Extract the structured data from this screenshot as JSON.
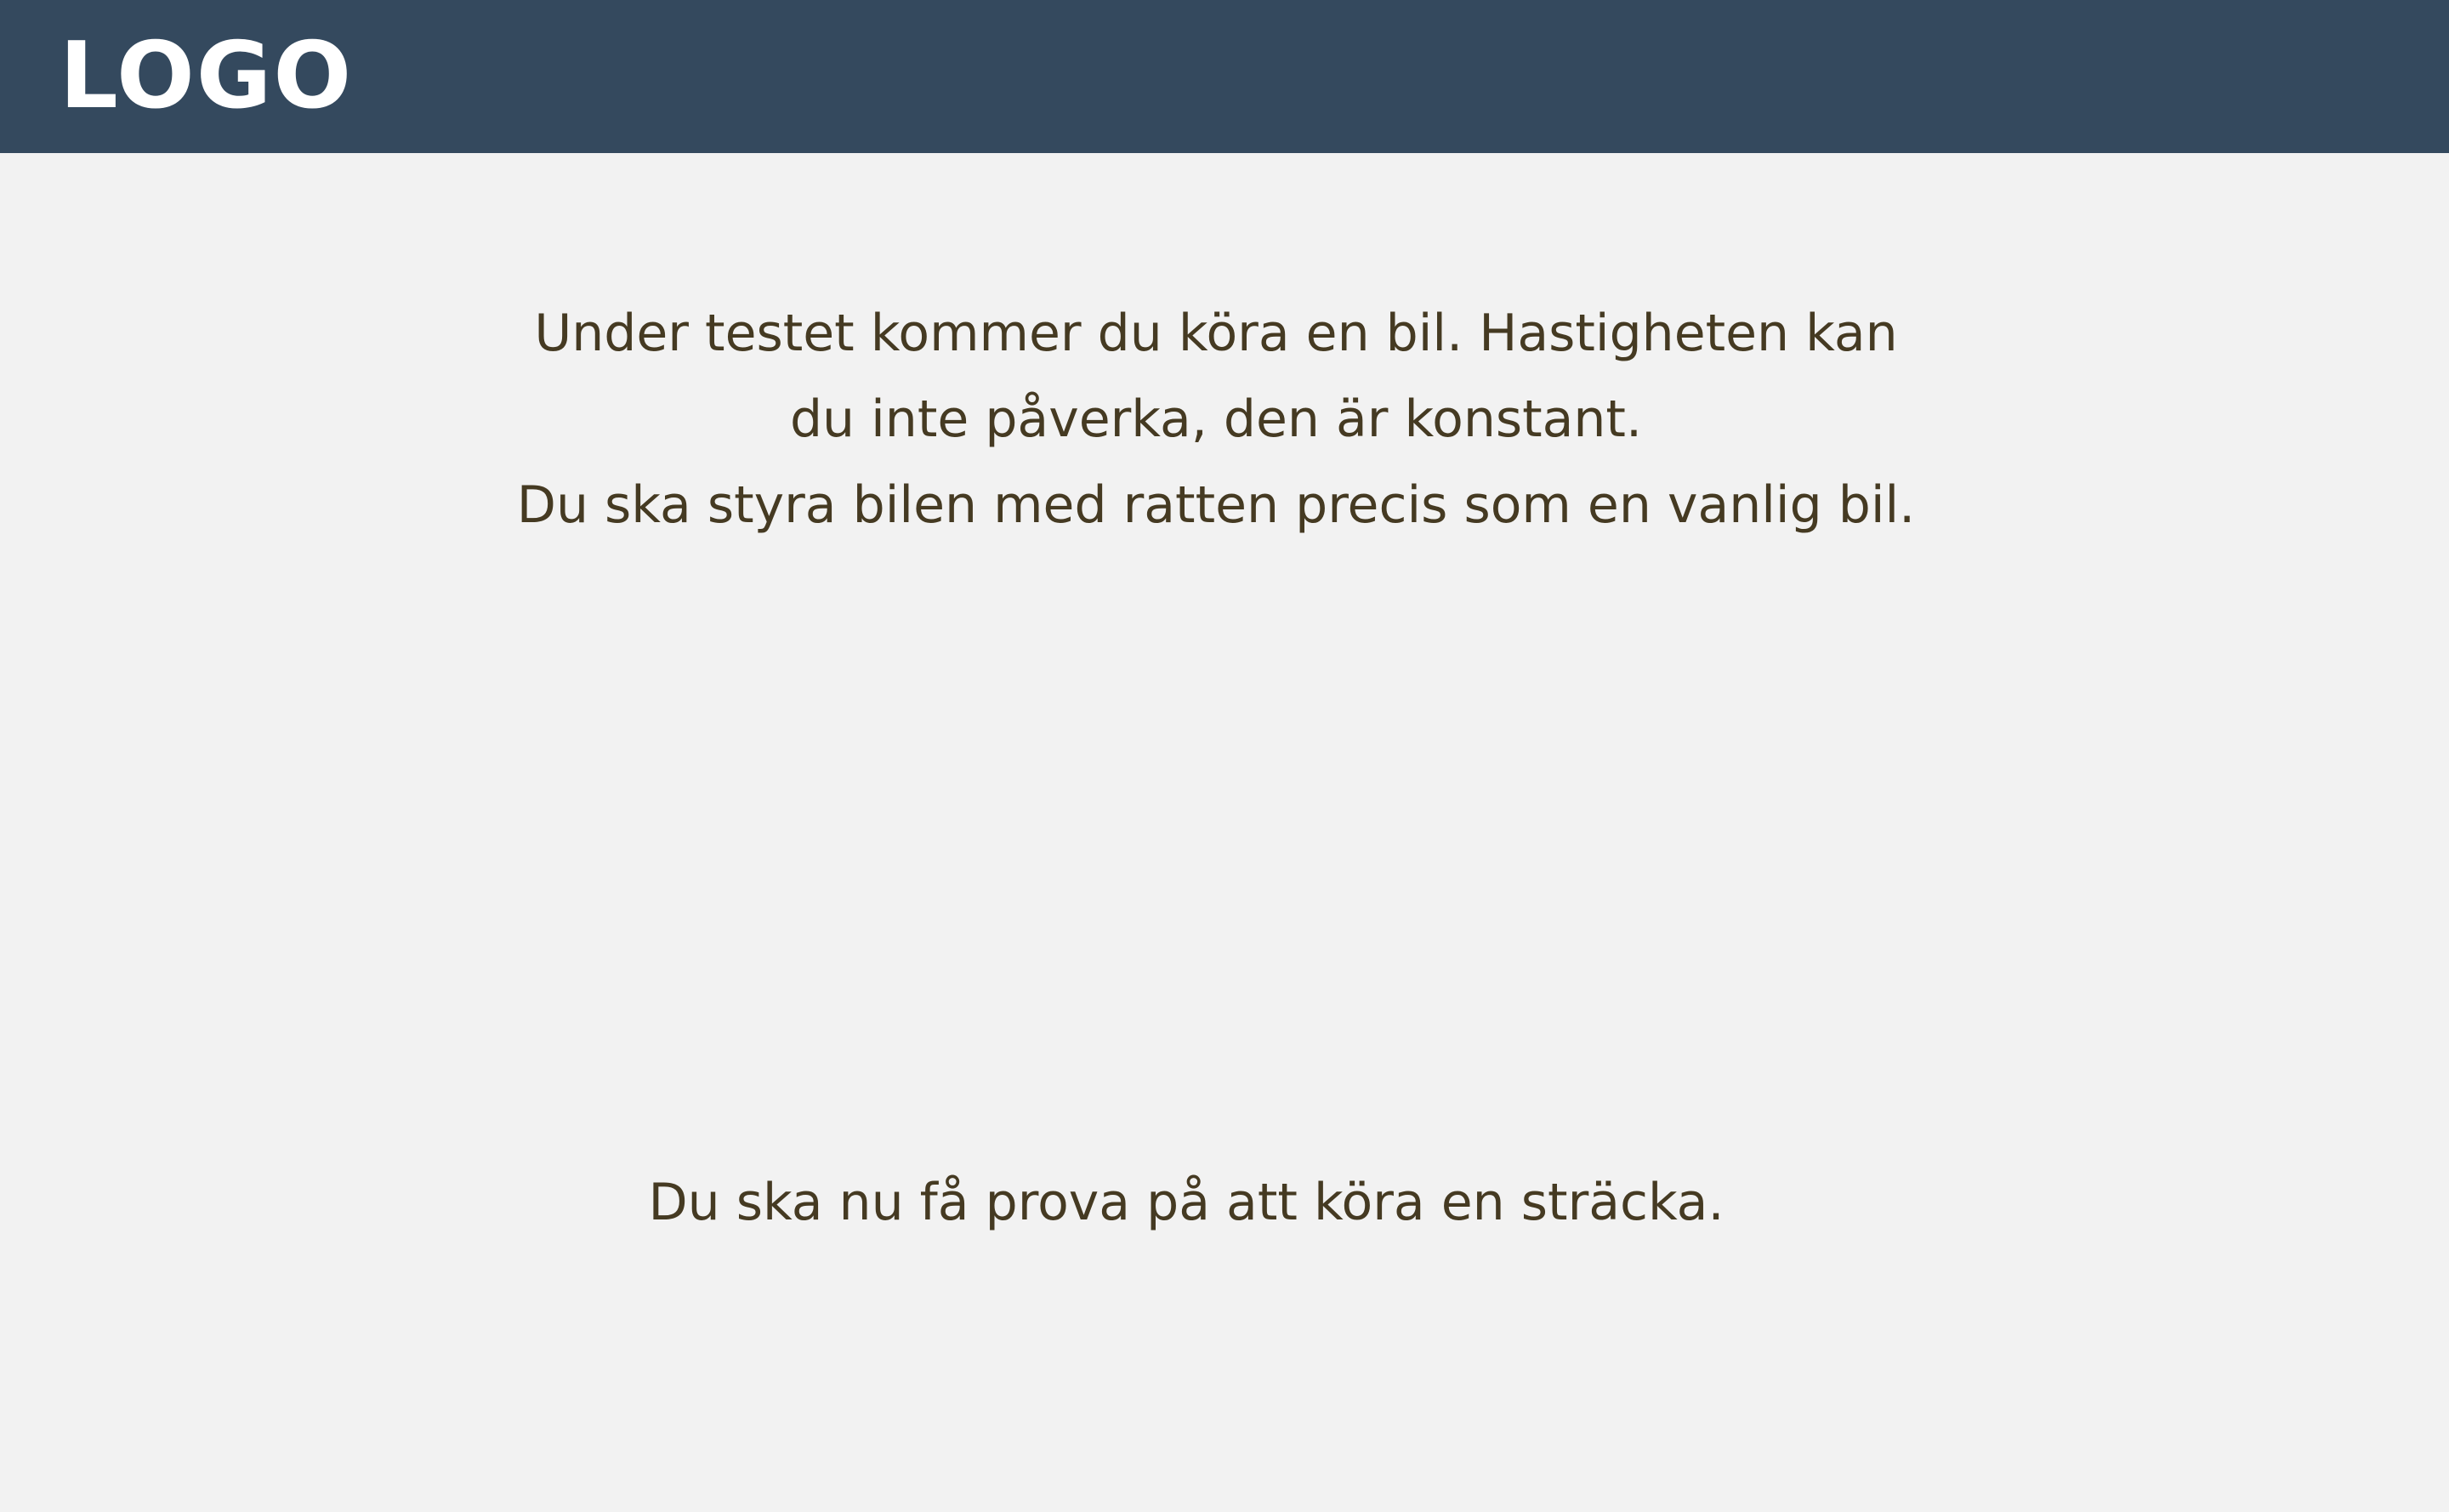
{
  "header": {
    "logo_text": "LOGO",
    "background_color": "#34495e"
  },
  "main": {
    "intro_lines": [
      "Under testet kommer du köra en bil. Hastigheten kan",
      "du inte påverka, den är konstant.",
      "Du ska styra bilen med ratten precis som en vanlig bil."
    ],
    "prompt": "Du ska nu få prova på att köra en sträcka.",
    "text_color": "#453a22",
    "background_color": "#f2f2f2"
  }
}
